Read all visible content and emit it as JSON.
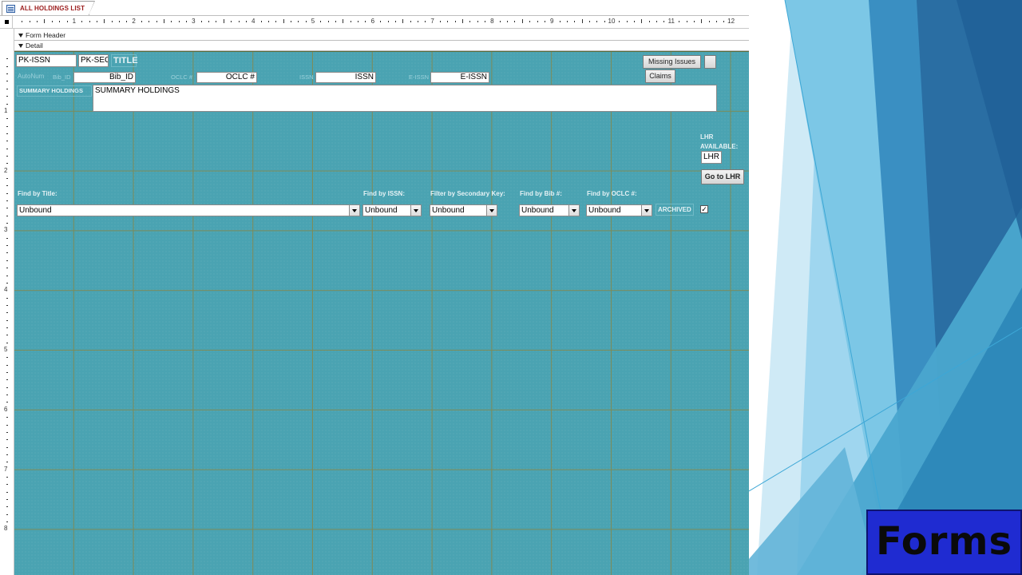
{
  "tab": {
    "title": "ALL HOLDINGS LIST"
  },
  "ruler": {
    "numbers": [
      "1",
      "2",
      "3",
      "4",
      "5",
      "6",
      "7",
      "8",
      "9",
      "10",
      "11",
      "12"
    ],
    "vnumbers": [
      "1",
      "2",
      "3",
      "4",
      "5",
      "6",
      "7",
      "8"
    ]
  },
  "sections": {
    "header": "Form Header",
    "detail": "Detail"
  },
  "fields": {
    "pk_issn": "PK-ISSN",
    "pk_sec": "PK-SEC",
    "title": "TITLE",
    "autonum": "AutoNum",
    "bib_id_label": "Bib_ID",
    "bib_id": "Bib_ID",
    "oclc_label": "OCLC #",
    "oclc": "OCLC #",
    "issn_label": "ISSN",
    "issn": "ISSN",
    "eissn_label": "E-ISSN",
    "eissn": "E-ISSN",
    "summary_label": "SUMMARY HOLDINGS",
    "summary": "SUMMARY HOLDINGS"
  },
  "buttons": {
    "missing_issues": "Missing Issues",
    "claims": "Claims",
    "go_to_lhr": "Go to LHR"
  },
  "lhr": {
    "label_line1": "LHR",
    "label_line2": "AVAILABLE:",
    "value": "LHR A"
  },
  "filters": {
    "title_label": "Find by Title:",
    "issn_label": "Find by ISSN:",
    "seckey_label": "Filter by Secondary Key:",
    "bib_label": "Find by Bib #:",
    "oclc_label": "Find by OCLC #:",
    "title_value": "Unbound",
    "issn_value": "Unbound",
    "seckey_value": "Unbound",
    "bib_value": "Unbound",
    "oclc_value": "Unbound",
    "archived_label": "ARCHIVED",
    "archived_mark": "✓"
  },
  "slide": {
    "caption": "Forms"
  },
  "colors": {
    "canvas": "#4aa3b2",
    "grid": "#7d8b58",
    "caption_bg": "#1f2bd1",
    "tab_text": "#9b1c1c"
  }
}
